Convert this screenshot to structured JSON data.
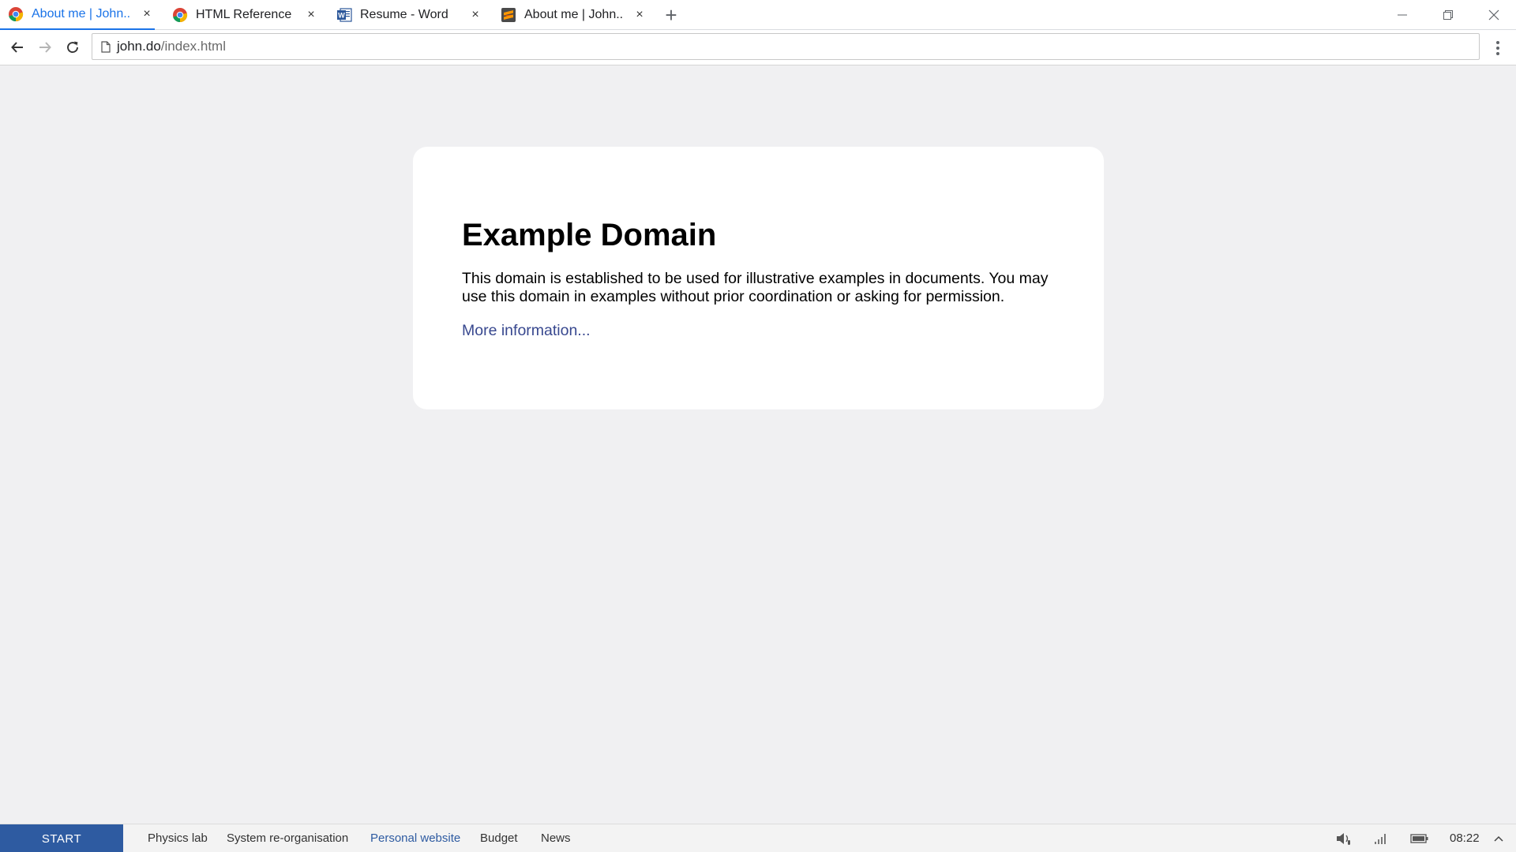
{
  "browser": {
    "tabs": [
      {
        "label": "About me | John...",
        "icon": "chrome-icon",
        "active": true
      },
      {
        "label": "HTML Reference ...",
        "icon": "chrome-icon",
        "active": false
      },
      {
        "label": "Resume - Word",
        "icon": "word-icon",
        "active": false
      },
      {
        "label": "About me | John...",
        "icon": "sublime-text-icon",
        "active": false
      }
    ],
    "new_tab_symbol": "+",
    "close_symbol": "×",
    "address": {
      "host": "john.do",
      "path": "/index.html"
    }
  },
  "page": {
    "heading": "Example Domain",
    "description": "This domain is established to be used for illustrative examples in documents. You may use this domain in examples without prior coordination or asking for permission.",
    "link_text": "More information..."
  },
  "taskbar": {
    "start_label": "START",
    "items": [
      {
        "label": "Physics lab",
        "active": false
      },
      {
        "label": "System re-organisation",
        "active": false
      },
      {
        "label": "Personal website",
        "active": true
      },
      {
        "label": "Budget",
        "active": false
      },
      {
        "label": "News",
        "active": false
      }
    ],
    "clock": "08:22",
    "tray_icons": [
      "speaker-icon",
      "signal-icon",
      "battery-icon",
      "chevron-up-icon"
    ]
  },
  "colors": {
    "accent": "#1a73e8",
    "start_bg": "#2e5ba1",
    "page_bg": "#f0f0f2",
    "link": "#38488f"
  }
}
